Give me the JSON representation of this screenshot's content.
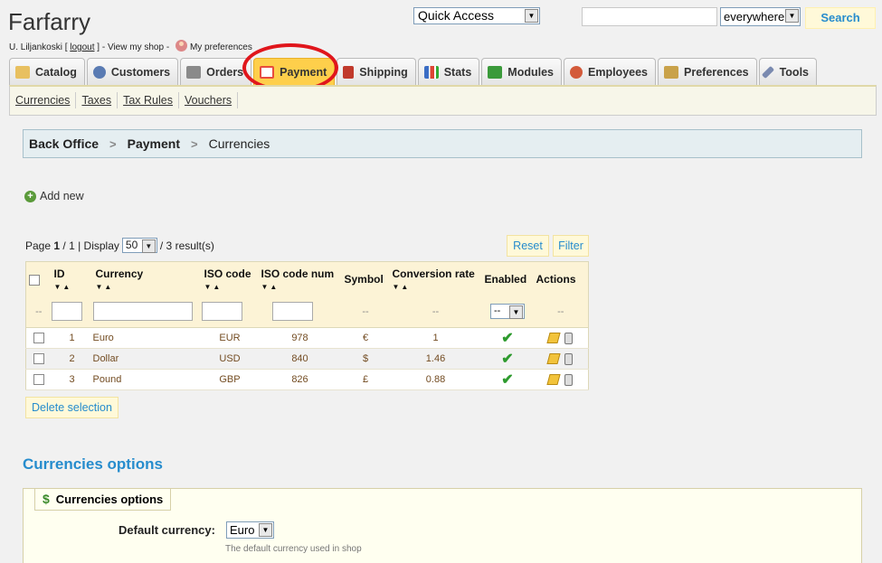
{
  "header": {
    "shop_name": "Farfarry",
    "user_name": "U. Liljankoski",
    "logout_label": "logout",
    "view_shop_label": "View my shop",
    "preferences_label": "My preferences",
    "quick_access": "Quick Access",
    "search_value": "",
    "search_scope": "everywhere",
    "search_button": "Search"
  },
  "tabs": [
    {
      "label": "Catalog",
      "icon": "folder-icon",
      "color": "#e8c060"
    },
    {
      "label": "Customers",
      "icon": "user-icon",
      "color": "#5a7bb3"
    },
    {
      "label": "Orders",
      "icon": "cart-icon",
      "color": "#8a8a8a"
    },
    {
      "label": "Payment",
      "icon": "payment-icon",
      "color": "#e84c3d",
      "active": true
    },
    {
      "label": "Shipping",
      "icon": "truck-icon",
      "color": "#c0392b"
    },
    {
      "label": "Stats",
      "icon": "chart-icon",
      "color": "#3b6dc4"
    },
    {
      "label": "Modules",
      "icon": "puzzle-icon",
      "color": "#3a9a3a"
    },
    {
      "label": "Employees",
      "icon": "employee-icon",
      "color": "#d35a3a"
    },
    {
      "label": "Preferences",
      "icon": "preferences-icon",
      "color": "#c9a24a"
    },
    {
      "label": "Tools",
      "icon": "wrench-icon",
      "color": "#7a8ab0"
    }
  ],
  "subnav": [
    "Currencies",
    "Taxes",
    "Tax Rules",
    "Vouchers"
  ],
  "breadcrumb": [
    "Back Office",
    "Payment",
    "Currencies"
  ],
  "add_new_label": "Add new",
  "pager": {
    "page_prefix": "Page",
    "page": "1",
    "total_pages": "/ 1 | Display",
    "per_page": "50",
    "results": "/ 3 result(s)"
  },
  "reset_label": "Reset",
  "filter_label": "Filter",
  "table": {
    "columns": [
      "ID",
      "Currency",
      "ISO code",
      "ISO code num",
      "Symbol",
      "Conversion rate",
      "Enabled",
      "Actions"
    ],
    "filter_placeholder": "--",
    "enabled_filter": "--",
    "rows": [
      {
        "id": "1",
        "currency": "Euro",
        "iso": "EUR",
        "iso_num": "978",
        "symbol": "€",
        "rate": "1"
      },
      {
        "id": "2",
        "currency": "Dollar",
        "iso": "USD",
        "iso_num": "840",
        "symbol": "$",
        "rate": "1.46"
      },
      {
        "id": "3",
        "currency": "Pound",
        "iso": "GBP",
        "iso_num": "826",
        "symbol": "£",
        "rate": "0.88"
      }
    ]
  },
  "delete_selection_label": "Delete selection",
  "options": {
    "section_title": "Currencies options",
    "legend": "Currencies options",
    "default_currency_label": "Default currency:",
    "default_currency_value": "Euro",
    "default_currency_help": "The default currency used in shop"
  },
  "colors": {
    "accent": "#268ccd",
    "active_tab": "#fecf4b",
    "annotation": "#e0161c"
  }
}
